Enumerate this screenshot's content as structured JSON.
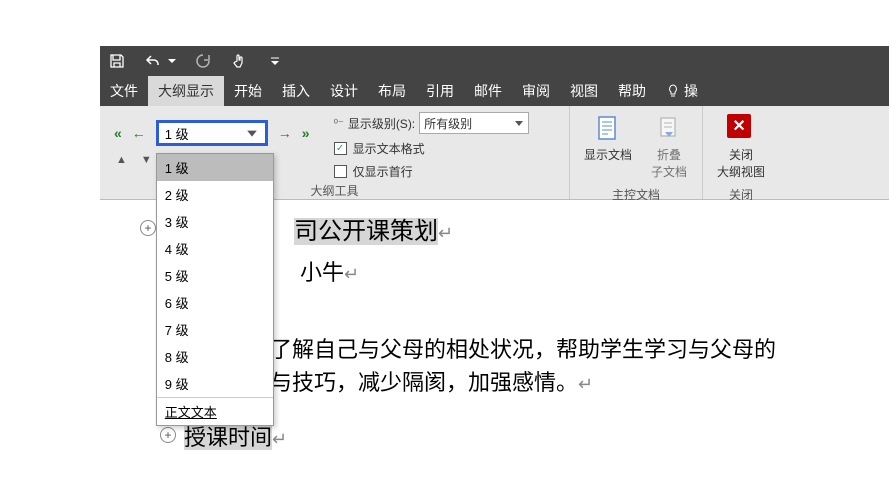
{
  "titlebar": {
    "save_icon": "save-icon",
    "undo_icon": "undo-icon",
    "redo_icon": "redo-icon",
    "touch_icon": "touch-mode-icon",
    "customize_icon": "customize-qat-icon"
  },
  "menubar": {
    "file": "文件",
    "outline": "大纲显示",
    "home": "开始",
    "insert": "插入",
    "design": "设计",
    "layout": "布局",
    "references": "引用",
    "mailings": "邮件",
    "review": "审阅",
    "view": "视图",
    "help": "帮助",
    "operate": "操"
  },
  "ribbon": {
    "outline_tools_label": "大纲工具",
    "master_doc_label": "主控文档",
    "close_group_label": "关闭",
    "level_selected": "1 级",
    "level_options": [
      "1 级",
      "2 级",
      "3 级",
      "4 级",
      "5 级",
      "6 级",
      "7 级",
      "8 级",
      "9 级",
      "正文文本"
    ],
    "show_level_label": "显示级别(S):",
    "show_level_value": "所有级别",
    "show_text_format": "显示文本格式",
    "show_first_line": "仅显示首行",
    "show_doc": "显示文档",
    "collapse_subdoc_l1": "折叠",
    "collapse_subdoc_l2": "子文档",
    "close_outline_l1": "关闭",
    "close_outline_l2": "大纲视图"
  },
  "document": {
    "title_partial": "司公开课策划",
    "author_partial": "小牛",
    "body_line1": "了解自己与父母的相处状况，帮助学生学习与父母的",
    "body_line2": "与技巧，减少隔阂，加强感情。",
    "heading2": "授课时间"
  }
}
